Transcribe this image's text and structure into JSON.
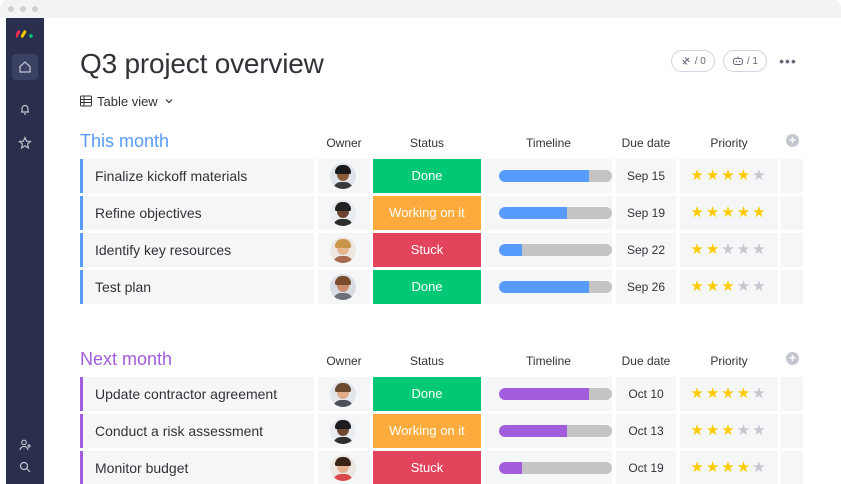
{
  "page": {
    "title": "Q3 project overview",
    "view_label": "Table view",
    "actions": {
      "integrate_count": "/ 0",
      "automate_count": "/ 1",
      "more": "•••"
    }
  },
  "columns": {
    "owner": "Owner",
    "status": "Status",
    "timeline": "Timeline",
    "due_date": "Due date",
    "priority": "Priority"
  },
  "colors": {
    "done": "#00c875",
    "working": "#fdab3d",
    "stuck": "#e2445c",
    "group_blue": "#579bfc",
    "group_purple": "#a25ddc"
  },
  "groups": [
    {
      "title": "This month",
      "color": "#579bfc",
      "rows": [
        {
          "name": "Finalize kickoff materials",
          "status": "Done",
          "status_key": "done",
          "timeline": 0.8,
          "due": "Sep 15",
          "priority": 4,
          "avatar": "person-1"
        },
        {
          "name": "Refine objectives",
          "status": "Working on it",
          "status_key": "working",
          "timeline": 0.6,
          "due": "Sep 19",
          "priority": 5,
          "avatar": "person-2"
        },
        {
          "name": "Identify key resources",
          "status": "Stuck",
          "status_key": "stuck",
          "timeline": 0.2,
          "due": "Sep 22",
          "priority": 2,
          "avatar": "person-3"
        },
        {
          "name": "Test plan",
          "status": "Done",
          "status_key": "done",
          "timeline": 0.8,
          "due": "Sep 26",
          "priority": 3,
          "avatar": "person-4"
        }
      ]
    },
    {
      "title": "Next month",
      "color": "#a25ddc",
      "rows": [
        {
          "name": "Update contractor agreement",
          "status": "Done",
          "status_key": "done",
          "timeline": 0.8,
          "due": "Oct 10",
          "priority": 4,
          "avatar": "person-5"
        },
        {
          "name": "Conduct a risk assessment",
          "status": "Working on it",
          "status_key": "working",
          "timeline": 0.6,
          "due": "Oct 13",
          "priority": 3,
          "avatar": "person-6"
        },
        {
          "name": "Monitor budget",
          "status": "Stuck",
          "status_key": "stuck",
          "timeline": 0.2,
          "due": "Oct 19",
          "priority": 4,
          "avatar": "person-7"
        }
      ]
    }
  ],
  "icons": {
    "home": "home-icon",
    "notifications": "bell-icon",
    "favorites": "star-icon",
    "invite": "add-person-icon",
    "search": "search-icon"
  }
}
